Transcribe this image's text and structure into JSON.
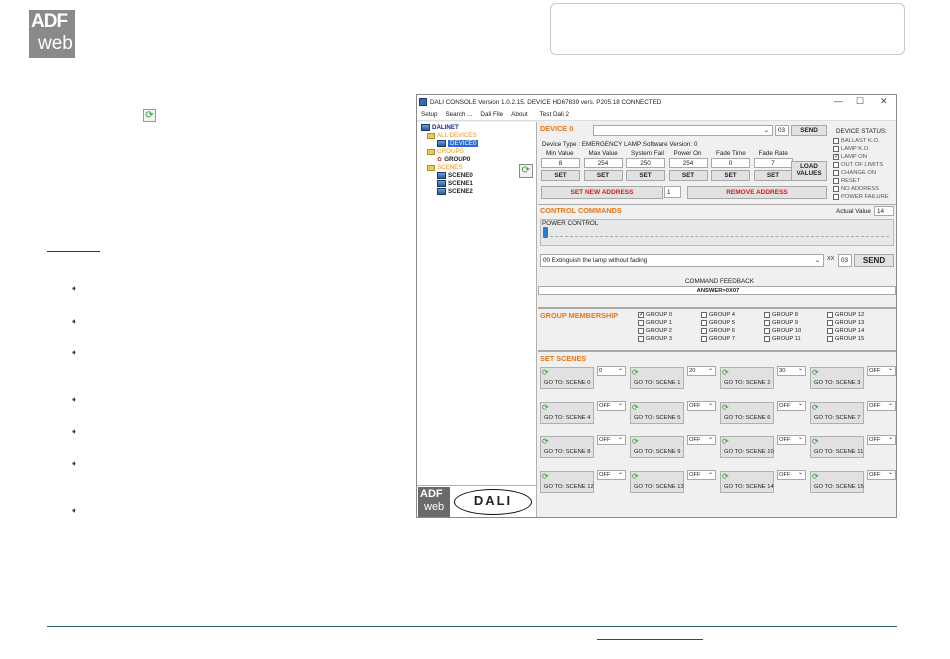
{
  "logo": {
    "line1": "ADF",
    "line2": "web"
  },
  "window": {
    "title": "DALI CONSOLE Version 1.0.2.15.  DEVICE HD67839    vers. P205.18 CONNECTED",
    "controls": [
      "—",
      "☐",
      "✕"
    ],
    "menu": [
      "Setup",
      "Search ...",
      "Dali File",
      "About",
      "Test Dali 2"
    ]
  },
  "tree": {
    "root": "DALINET",
    "all_devices": "ALL DEVICES",
    "device": "DEVICE0",
    "groups": "GROUPS",
    "group0": "GROUP0",
    "scenes": "SCENES",
    "scene_items": [
      "SCENE0",
      "SCENE1",
      "SCENE2"
    ]
  },
  "bottom_logo": {
    "adf": "ADF",
    "web": "web",
    "dali": "DALI"
  },
  "device": {
    "header": "DEVICE 0",
    "address": "03",
    "send": "SEND",
    "info": "Device Type : EMERGENCY LAMP   Software Version: 0",
    "status_title": "DEVICE STATUS:",
    "status": [
      {
        "label": "BALLAST K.O.",
        "checked": false
      },
      {
        "label": "LAMP K.O.",
        "checked": false
      },
      {
        "label": "LAMP ON",
        "checked": true
      },
      {
        "label": "OUT OF LIMITS",
        "checked": false
      },
      {
        "label": "CHANGE ON",
        "checked": false
      },
      {
        "label": "RESET",
        "checked": false
      },
      {
        "label": "NO ADDRESS",
        "checked": false
      },
      {
        "label": "POWER FAILURE",
        "checked": false
      }
    ],
    "param_labels": [
      "Min Value",
      "Max Value",
      "System Fail",
      "Power On",
      "Fade Time",
      "Fade Rate"
    ],
    "param_values": [
      "8",
      "254",
      "250",
      "254",
      "0",
      "7"
    ],
    "set": "SET",
    "load_values": "LOAD VALUES",
    "set_new_address": "SET NEW ADDRESS",
    "new_address": "1",
    "remove_address": "REMOVE  ADDRESS"
  },
  "control": {
    "header": "CONTROL COMMANDS",
    "actual_label": "Actual Value",
    "actual_value": "14",
    "power_control": "POWER CONTROL",
    "command": "00 Extinguish the lamp without fading",
    "xx": "XX",
    "xx_value": "03",
    "send": "SEND",
    "feedback_label": "COMMAND FEEDBACK",
    "feedback_value": "ANSWER=0X07",
    "slider_fraction": 0.0
  },
  "groups": {
    "header": "GROUP MEMBERSHIP",
    "items": [
      {
        "label": "GROUP 0",
        "checked": true
      },
      {
        "label": "GROUP 1",
        "checked": false
      },
      {
        "label": "GROUP 2",
        "checked": false
      },
      {
        "label": "GROUP 3",
        "checked": false
      },
      {
        "label": "GROUP 4",
        "checked": false
      },
      {
        "label": "GROUP 5",
        "checked": false
      },
      {
        "label": "GROUP 6",
        "checked": false
      },
      {
        "label": "GROUP 7",
        "checked": false
      },
      {
        "label": "GROUP 8",
        "checked": false
      },
      {
        "label": "GROUP 9",
        "checked": false
      },
      {
        "label": "GROUP 10",
        "checked": false
      },
      {
        "label": "GROUP 11",
        "checked": false
      },
      {
        "label": "GROUP 12",
        "checked": false
      },
      {
        "label": "GROUP 13",
        "checked": false
      },
      {
        "label": "GROUP 14",
        "checked": false
      },
      {
        "label": "GROUP 15",
        "checked": false
      }
    ]
  },
  "scenes": {
    "header": "SET SCENES",
    "items": [
      {
        "label": "GO TO: SCENE 0",
        "value": "0"
      },
      {
        "label": "GO TO: SCENE 1",
        "value": "20"
      },
      {
        "label": "GO TO: SCENE 2",
        "value": "30"
      },
      {
        "label": "GO TO: SCENE 3",
        "value": "OFF"
      },
      {
        "label": "GO TO: SCENE 4",
        "value": "OFF"
      },
      {
        "label": "GO TO: SCENE 5",
        "value": "OFF"
      },
      {
        "label": "GO TO: SCENE 6",
        "value": "OFF"
      },
      {
        "label": "GO TO: SCENE 7",
        "value": "OFF"
      },
      {
        "label": "GO TO: SCENE 8",
        "value": "OFF"
      },
      {
        "label": "GO TO: SCENE 9",
        "value": "OFF"
      },
      {
        "label": "GO TO: SCENE 10",
        "value": "OFF"
      },
      {
        "label": "GO TO: SCENE 11",
        "value": "OFF"
      },
      {
        "label": "GO TO: SCENE 12",
        "value": "OFF"
      },
      {
        "label": "GO TO: SCENE 13",
        "value": "OFF"
      },
      {
        "label": "GO TO: SCENE 14",
        "value": "OFF"
      },
      {
        "label": "GO TO: SCENE 15",
        "value": "OFF"
      }
    ]
  }
}
